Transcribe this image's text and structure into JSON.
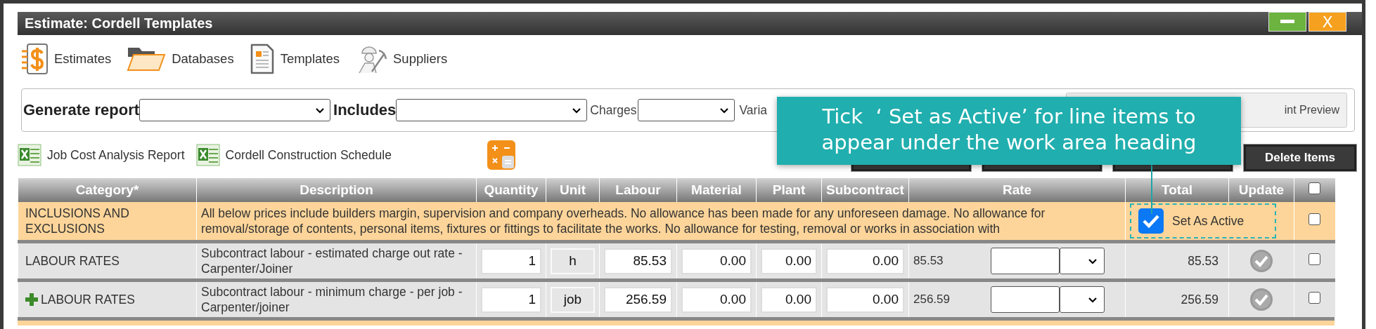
{
  "window": {
    "title": "Estimate: Cordell Templates",
    "close_label": "X"
  },
  "nav": [
    {
      "kind": "estimates",
      "label": "Estimates"
    },
    {
      "kind": "databases",
      "label": "Databases"
    },
    {
      "kind": "templates",
      "label": "Templates"
    },
    {
      "kind": "suppliers",
      "label": "Suppliers"
    }
  ],
  "report_bar": {
    "generate_label": "Generate report",
    "includes_label": "Includes",
    "charges_label": "Charges",
    "variations_label": "Varia",
    "preview_label": "int Preview"
  },
  "links": [
    {
      "label": "Job Cost Analysis Report"
    },
    {
      "label": "Cordell Construction Schedule"
    }
  ],
  "action_buttons": [
    {
      "kind": "covered"
    },
    {
      "kind": "covered"
    },
    {
      "kind": "covered"
    },
    {
      "kind": "button",
      "label": "Delete Items"
    }
  ],
  "callout": {
    "text": "Tick  ‘ Set as Active’ for line items to appear under the work area heading"
  },
  "table": {
    "columns": [
      "Category*",
      "Description",
      "Quantity",
      "Unit",
      "Labour",
      "Material",
      "Plant",
      "Subcontract",
      "Rate",
      "Total",
      "Update"
    ],
    "select_all": {
      "checked": false
    },
    "rows": [
      {
        "kind": "note",
        "category": "INCLUSIONS AND EXCLUSIONS",
        "description": "All below prices include builders margin, supervision and company overheads. No allowance has been made for any unforeseen damage. No allowance for removal/storage of contents, personal items, fixtures or fittings to facilitate the works. No allowance for testing, removal or works in association with",
        "active_label": "Set As Active",
        "active": true,
        "checked": false
      },
      {
        "kind": "item",
        "plus": false,
        "category": "LABOUR RATES",
        "description": "Subcontract labour - estimated charge out rate - Carpenter/Joiner",
        "quantity": "1",
        "unit": "h",
        "labour": "85.53",
        "material": "0.00",
        "plant": "0.00",
        "subcontract": "0.00",
        "rate": "85.53",
        "total": "85.53",
        "checked": false
      },
      {
        "kind": "item",
        "plus": true,
        "category": "LABOUR RATES",
        "description": "Subcontract labour - minimum charge - per job - Carpenter/joiner",
        "quantity": "1",
        "unit": "job",
        "labour": "256.59",
        "material": "0.00",
        "plant": "0.00",
        "subcontract": "0.00",
        "rate": "256.59",
        "total": "256.59",
        "checked": false
      }
    ]
  }
}
